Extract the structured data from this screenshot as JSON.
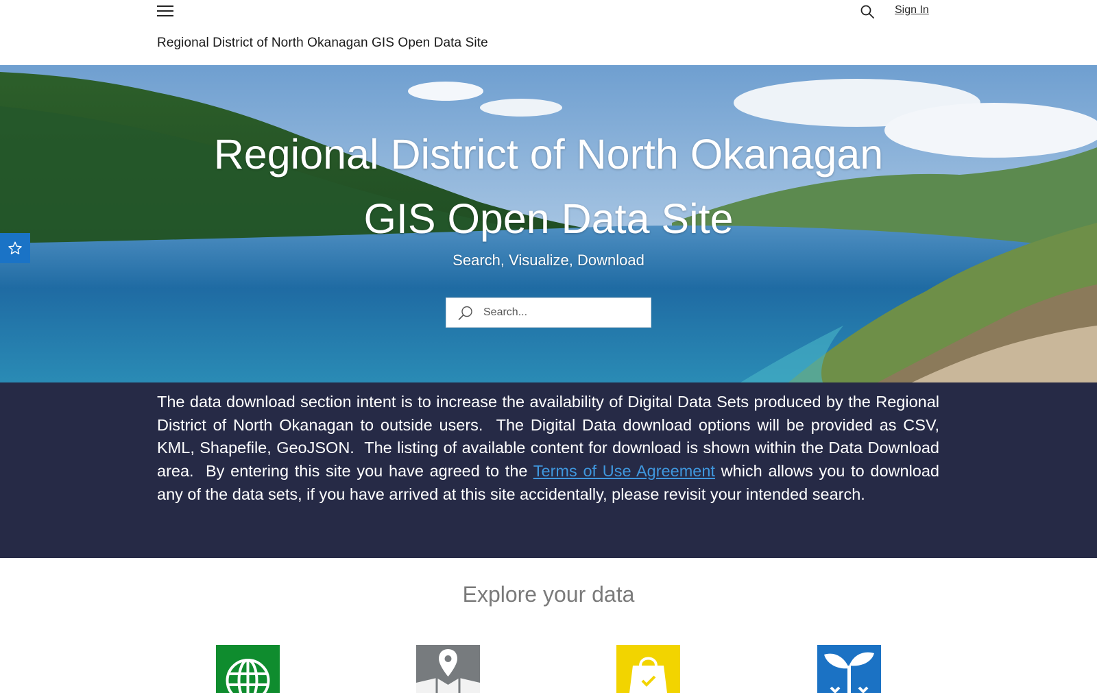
{
  "header": {
    "menu_icon": "hamburger-menu-icon",
    "search_icon": "search-icon",
    "sign_in_label": "Sign In",
    "site_title": "Regional District of North Okanagan GIS Open Data Site"
  },
  "hero": {
    "title_line1": "Regional District of North Okanagan",
    "title_line2": "GIS Open Data Site",
    "subtitle": "Search, Visualize, Download",
    "search_placeholder": "Search...",
    "favorites_icon": "star-icon"
  },
  "intro": {
    "text_before_link": "The data download section intent is to increase the availability of Digital Data Sets produced by the Regional District of North Okanagan to outside users.  The Digital Data download options will be provided as CSV, KML, Shapefile, GeoJSON.  The listing of available content for download is shown within the Data Download area.  By entering this site you have agreed to the ",
    "link_label": "Terms of Use Agreement",
    "text_after_link": " which allows you to download any of the data sets, if you have arrived at this site accidentally, please revisit your intended search."
  },
  "explore": {
    "heading": "Explore your data",
    "categories": [
      {
        "icon": "globe-icon",
        "color": "#0f8c2e"
      },
      {
        "icon": "map-pin-icon",
        "color": "#777b7e"
      },
      {
        "icon": "shopping-bag-icon",
        "color": "#f2d400"
      },
      {
        "icon": "plant-sprout-icon",
        "color": "#1b72c4"
      }
    ]
  },
  "colors": {
    "intro_band": "#262a46",
    "link": "#3f97de",
    "favorites_tab": "#1a73c6"
  }
}
